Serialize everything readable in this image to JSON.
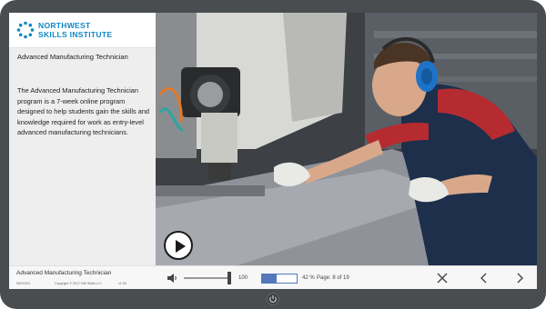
{
  "sidebar": {
    "logo": {
      "line1": "NORTHWEST",
      "line2": "SKILLS INSTITUTE",
      "color": "#0e88c6"
    },
    "course_title": "Advanced Manufacturing Technician",
    "course_description": "The Advanced Manufacturing Technician program is a 7-week online program designed to help students gain the skills and knowledge required for work as entry-level advanced manufacturing technicians."
  },
  "video": {
    "play_icon": "play-icon"
  },
  "controls": {
    "title": "Advanced Manufacturing Technician",
    "code": "59XXX01",
    "copyright": "Copyright © 2017 NW Skills LLC",
    "version": "v1.05",
    "volume": "100",
    "volume_icon": "speaker-icon",
    "progress_fraction": 0.42,
    "progress_percent": "42 %",
    "page_label": "Page: 8 of 19",
    "close_icon": "close-icon",
    "prev_icon": "chevron-left-icon",
    "next_icon": "chevron-right-icon",
    "accent": "#5577bb"
  },
  "device": {
    "power_icon": "power-icon"
  }
}
